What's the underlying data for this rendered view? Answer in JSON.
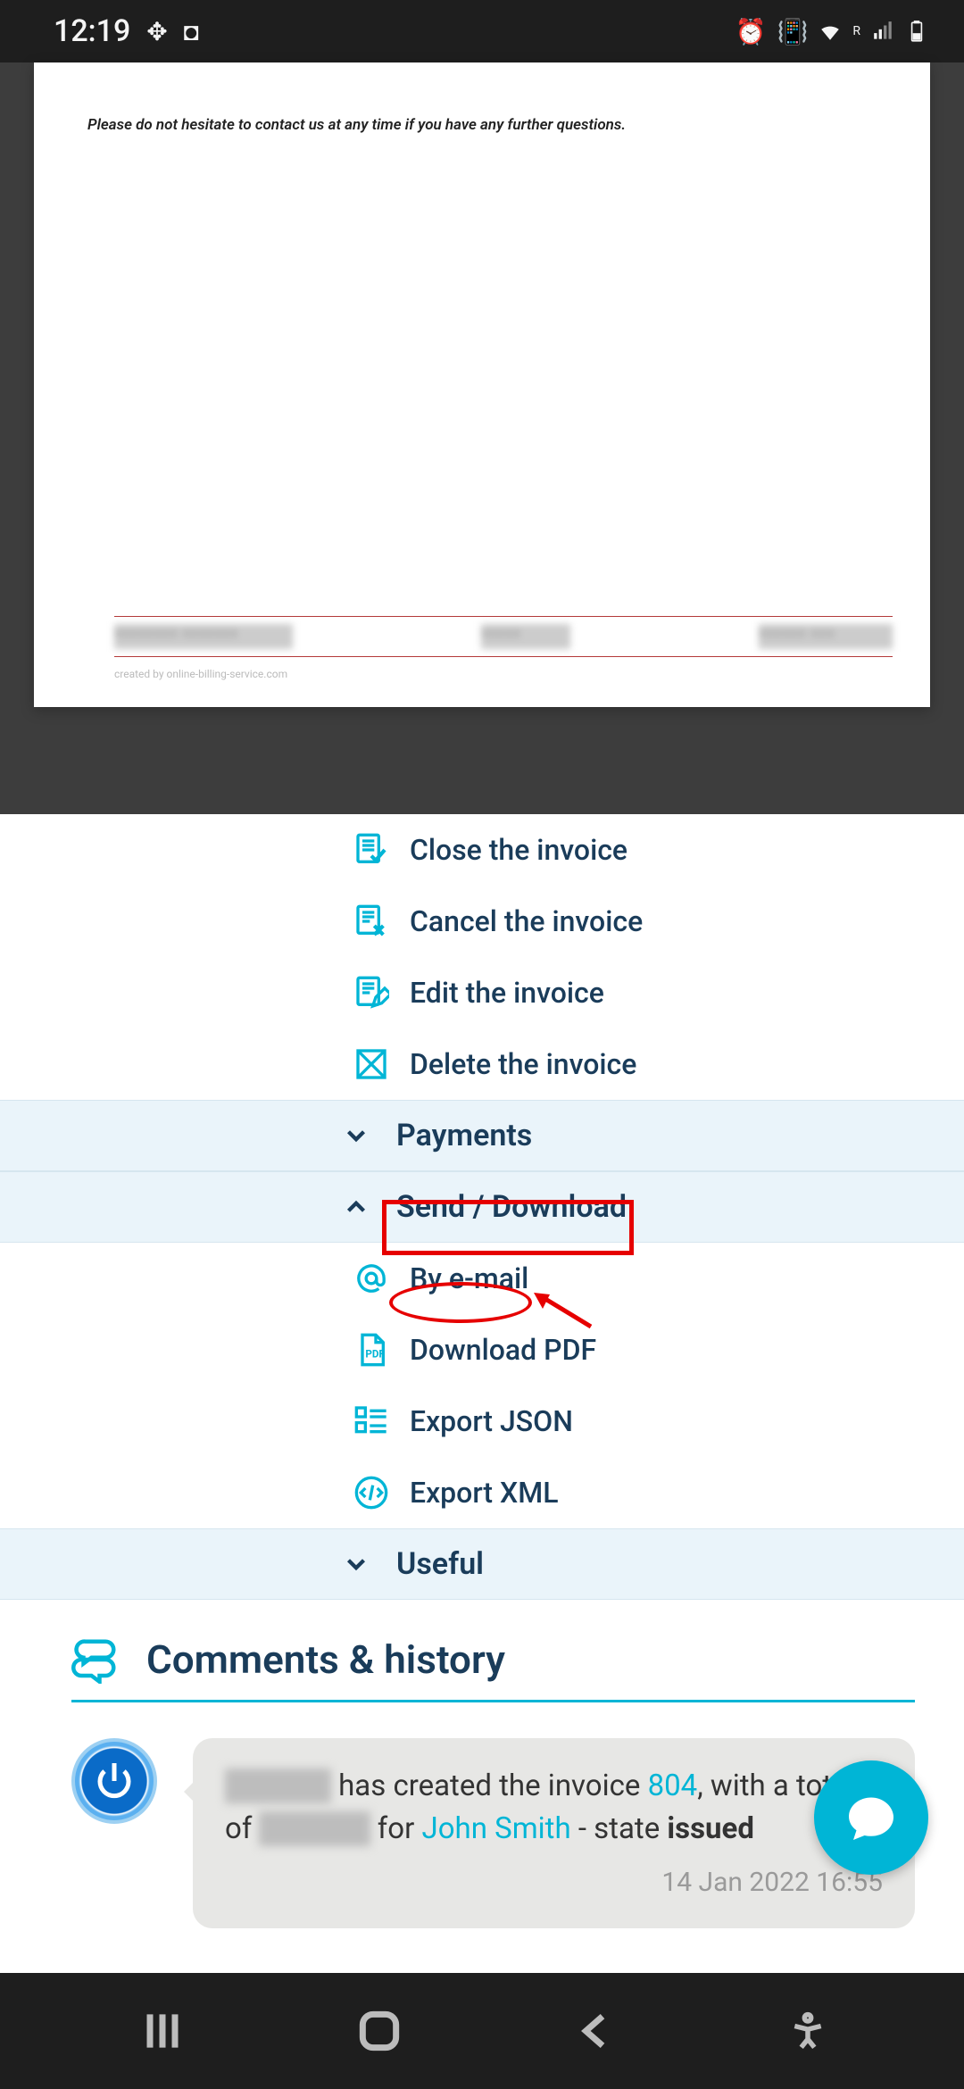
{
  "status": {
    "time": "12:19"
  },
  "document": {
    "notice": "Please do not hesitate to contact us at any time if you have any further questions.",
    "credit": "created by online-billing-service.com"
  },
  "actions": {
    "close": "Close the invoice",
    "cancel": "Cancel the invoice",
    "edit": "Edit the invoice",
    "delete": "Delete the invoice"
  },
  "sections": {
    "payments": "Payments",
    "send_download": "Send / Download",
    "useful": "Useful"
  },
  "send_items": {
    "email": "By e-mail",
    "pdf": "Download PDF",
    "json": "Export JSON",
    "xml": "Export XML"
  },
  "comments": {
    "title": "Comments & history",
    "entry": {
      "text_pre": " has created the invoice ",
      "invoice_no": "804",
      "text_mid": ", with a total of ",
      "text_for": " for ",
      "client": "John Smith",
      "text_state": " - state ",
      "state": "issued",
      "time": "14 Jan 2022 16:55"
    }
  }
}
